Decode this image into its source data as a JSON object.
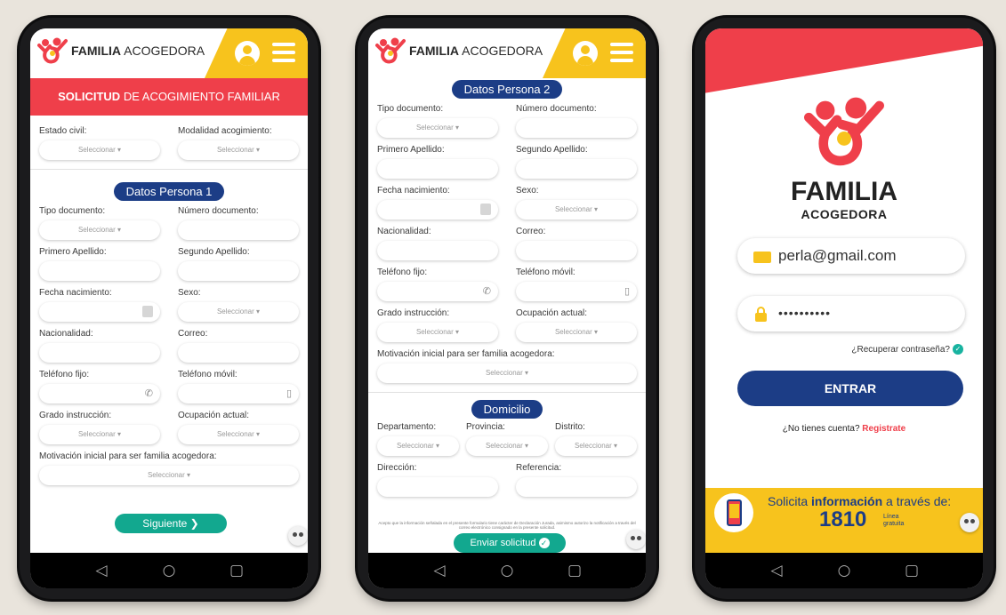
{
  "brand": {
    "name_bold": "FAMILIA",
    "name_rest": " ACOGEDORA"
  },
  "screen1": {
    "title_bold": "SOLICITUD",
    "title_rest": " DE ACOGIMIENTO FAMILIAR",
    "estado_civil": {
      "label": "Estado civil:",
      "value": "Seleccionar ▾"
    },
    "modalidad": {
      "label": "Modalidad acogimiento:",
      "value": "Seleccionar ▾"
    },
    "section": "Datos Persona 1",
    "tipo_doc": {
      "label": "Tipo documento:",
      "value": "Seleccionar ▾"
    },
    "num_doc": {
      "label": "Número documento:"
    },
    "primer_apellido": {
      "label": "Primero Apellido:"
    },
    "segundo_apellido": {
      "label": "Segundo Apellido:"
    },
    "fecha_nac": {
      "label": "Fecha nacimiento:"
    },
    "sexo": {
      "label": "Sexo:",
      "value": "Seleccionar ▾"
    },
    "nacionalidad": {
      "label": "Nacionalidad:"
    },
    "correo": {
      "label": "Correo:"
    },
    "tel_fijo": {
      "label": "Teléfono fijo:"
    },
    "tel_movil": {
      "label": "Teléfono móvil:"
    },
    "grado": {
      "label": "Grado instrucción:",
      "value": "Seleccionar ▾"
    },
    "ocupacion": {
      "label": "Ocupación actual:",
      "value": "Seleccionar ▾"
    },
    "motivacion": {
      "label": "Motivación inicial para ser familia acogedora:",
      "value": "Seleccionar ▾"
    },
    "next_button": "Siguiente ❯"
  },
  "screen2": {
    "section": "Datos Persona 2",
    "tipo_doc": {
      "label": "Tipo documento:",
      "value": "Seleccionar ▾"
    },
    "num_doc": {
      "label": "Número documento:"
    },
    "primer_apellido": {
      "label": "Primero Apellido:"
    },
    "segundo_apellido": {
      "label": "Segundo Apellido:"
    },
    "fecha_nac": {
      "label": "Fecha nacimiento:"
    },
    "sexo": {
      "label": "Sexo:",
      "value": "Seleccionar ▾"
    },
    "nacionalidad": {
      "label": "Nacionalidad:"
    },
    "correo": {
      "label": "Correo:"
    },
    "tel_fijo": {
      "label": "Teléfono fijo:"
    },
    "tel_movil": {
      "label": "Teléfono móvil:"
    },
    "grado": {
      "label": "Grado instrucción:",
      "value": "Seleccionar ▾"
    },
    "ocupacion": {
      "label": "Ocupación actual:",
      "value": "Seleccionar ▾"
    },
    "motivacion": {
      "label": "Motivación inicial para ser familia acogedora:",
      "value": "Seleccionar ▾"
    },
    "domicilio": "Domicilio",
    "departamento": {
      "label": "Departamento:",
      "value": "Seleccionar ▾"
    },
    "provincia": {
      "label": "Provincia:",
      "value": "Seleccionar ▾"
    },
    "distrito": {
      "label": "Distrito:",
      "value": "Seleccionar ▾"
    },
    "direccion": {
      "label": "Dirección:"
    },
    "referencia": {
      "label": "Referencia:"
    },
    "disclaimer": "Acepto que la información señalada en el presente formulario tiene carácter de Declaración Jurada, asimismo autorizo la notificación a través del correo electrónico consignado en la presente solicitud.",
    "submit_button": "Enviar solicitud"
  },
  "screen3": {
    "logo_line1": "FAMILIA",
    "logo_line2": "ACOGEDORA",
    "email_value": "perla@gmail.com",
    "password_mask": "••••••••••",
    "recover_link": "¿Recuperar contraseña?",
    "login_button": "ENTRAR",
    "no_account": "¿No tienes cuenta? ",
    "register_link": "Registrate",
    "footer_text_pre": "Solicita ",
    "footer_text_bold": "información",
    "footer_text_post": " a través de:",
    "footer_number": "1810",
    "footer_line1": "Línea",
    "footer_line2": "gratuita"
  },
  "nav": {
    "back": "◁",
    "home": "○",
    "recent": "▢"
  },
  "colors": {
    "red": "#ef3f4a",
    "yellow": "#f7c31d",
    "navy": "#1c3d86",
    "teal": "#12a88f"
  }
}
